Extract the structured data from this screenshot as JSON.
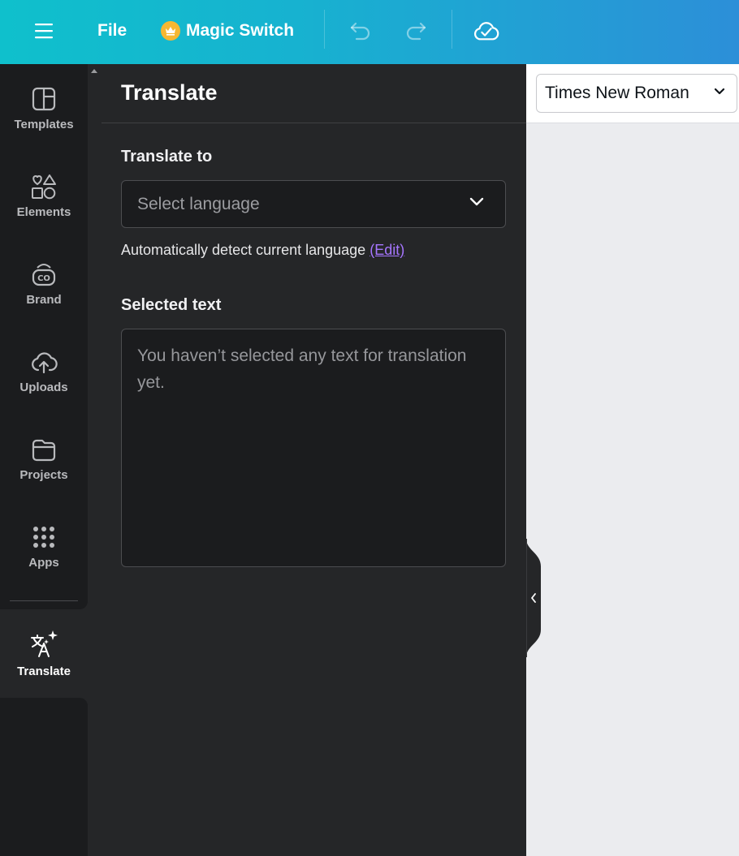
{
  "topbar": {
    "menu_icon": "hamburger-menu-icon",
    "file_label": "File",
    "magic_switch_label": "Magic Switch",
    "magic_switch_icon": "crown-icon",
    "undo_icon": "undo-icon",
    "redo_icon": "redo-icon",
    "save_status_icon": "cloud-check-icon",
    "colors": {
      "gradient_start": "#0fc0cc",
      "gradient_end": "#2c8fd8",
      "crown": "#f7b731"
    }
  },
  "sidebar": {
    "items": [
      {
        "label": "Templates",
        "icon": "templates-icon"
      },
      {
        "label": "Elements",
        "icon": "elements-icon"
      },
      {
        "label": "Brand",
        "icon": "brand-icon"
      },
      {
        "label": "Uploads",
        "icon": "uploads-icon"
      },
      {
        "label": "Projects",
        "icon": "projects-icon"
      },
      {
        "label": "Apps",
        "icon": "apps-grid-icon"
      }
    ],
    "active_item": {
      "label": "Translate",
      "icon": "translate-icon"
    }
  },
  "panel": {
    "title": "Translate",
    "translate_to_label": "Translate to",
    "language_select": {
      "placeholder": "Select language",
      "value": ""
    },
    "detect_text": "Automatically detect current language",
    "edit_link": "(Edit)",
    "selected_text_label": "Selected text",
    "selected_text_placeholder": "You haven’t selected any text for translation yet.",
    "link_color": "#a676ff"
  },
  "canvas": {
    "font_select": {
      "value": "Times New Roman"
    }
  }
}
